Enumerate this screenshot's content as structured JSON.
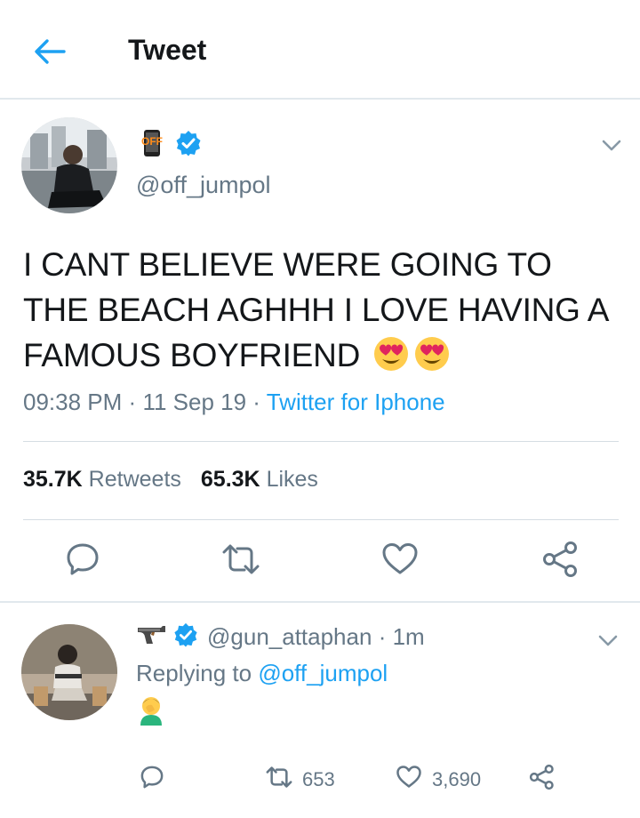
{
  "header": {
    "title": "Tweet"
  },
  "tweet": {
    "author_handle": "@off_jumpol",
    "text": "I CANT BELIEVE WERE GOING TO THE BEACH AGHHH I LOVE HAVING A FAMOUS BOYFRIEND",
    "time": "09:38 PM",
    "date": "11 Sep 19",
    "separator": "·",
    "source": "Twitter for Iphone",
    "retweets_count": "35.7K",
    "retweets_label": "Retweets",
    "likes_count": "65.3K",
    "likes_label": "Likes"
  },
  "reply": {
    "author_handle": "@gun_attaphan",
    "separator": "·",
    "time_ago": "1m",
    "replying_prefix": "Replying to",
    "replying_to": "@off_jumpol",
    "retweet_count": "653",
    "like_count": "3,690"
  },
  "colors": {
    "accent": "#1da1f2",
    "muted": "#657786",
    "text": "#14171a",
    "verified": "#1da1f2"
  }
}
